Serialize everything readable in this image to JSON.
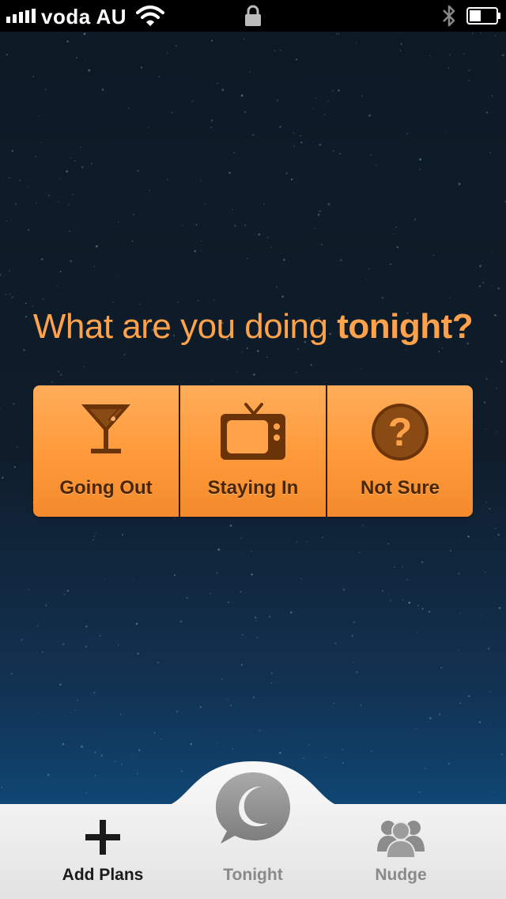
{
  "status_bar": {
    "carrier": "voda  AU",
    "signal_bars": 5
  },
  "main": {
    "headline_regular": "What are you doing ",
    "headline_bold": "tonight?",
    "accent_color": "#ffa24a",
    "choices": [
      {
        "label": "Going Out",
        "icon": "cocktail-glass-icon"
      },
      {
        "label": "Staying In",
        "icon": "tv-icon"
      },
      {
        "label": "Not Sure",
        "icon": "question-mark-icon"
      }
    ]
  },
  "tab_bar": {
    "tabs": [
      {
        "label": "Add Plans",
        "icon": "plus-icon"
      },
      {
        "label": "Tonight",
        "icon": "moon-chat-bubble-icon"
      },
      {
        "label": "Nudge",
        "icon": "group-people-icon"
      }
    ]
  }
}
